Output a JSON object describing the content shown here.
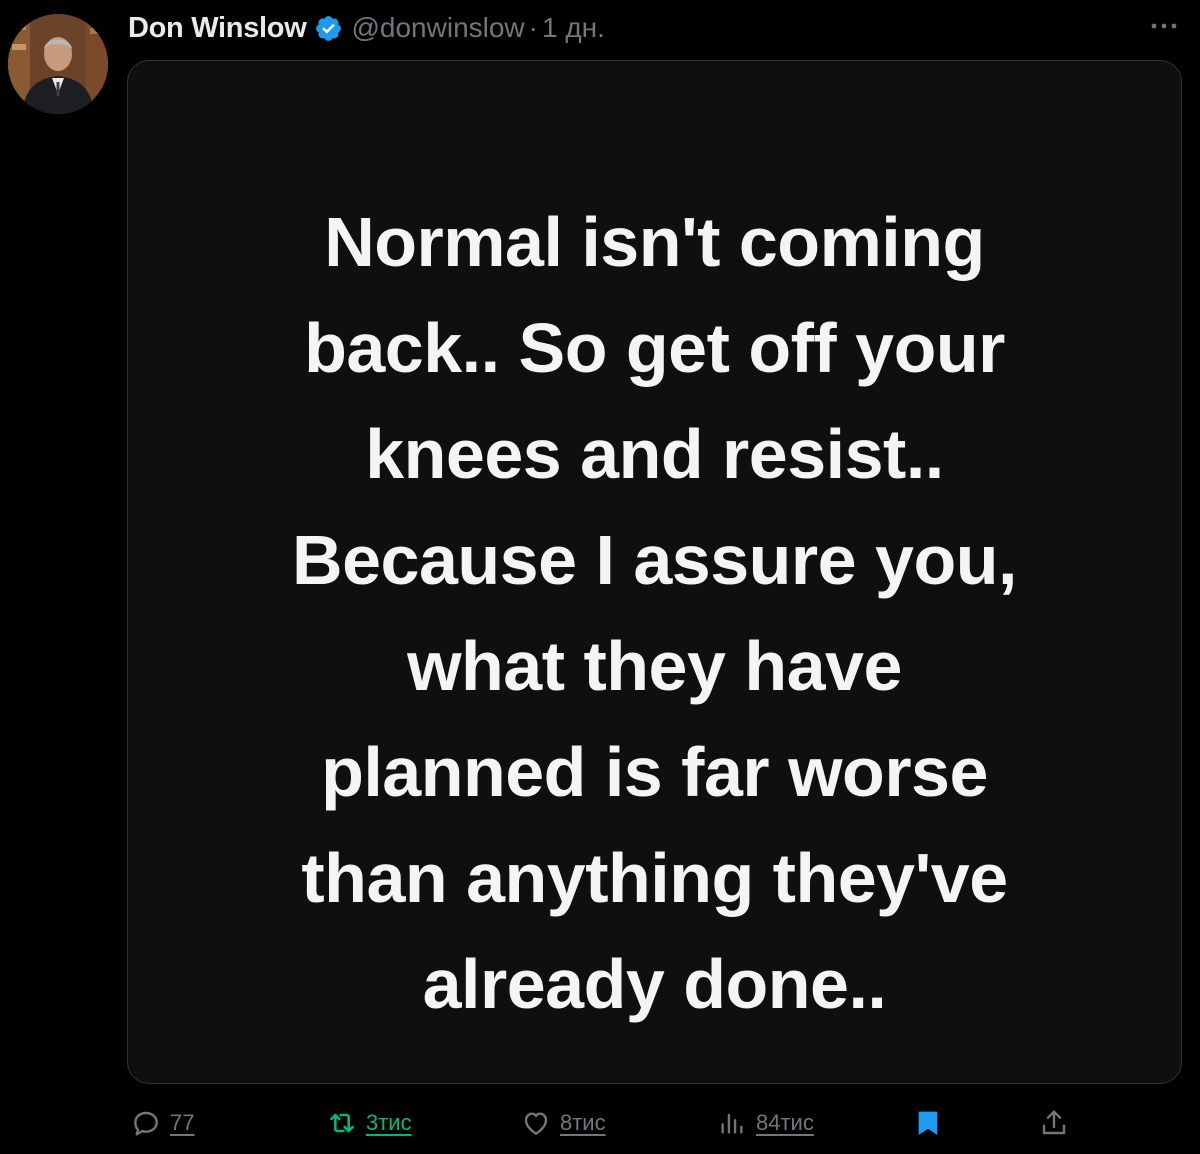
{
  "author": {
    "display_name": "Don Winslow",
    "handle": "@donwinslow",
    "separator": "·",
    "time_ago": "1 дн.",
    "verified_color": "#1d9bf0"
  },
  "media": {
    "lines": [
      "Normal isn't coming",
      "back.. So get off your",
      "knees and resist..",
      "Because I assure you,",
      "what they have",
      "planned is far worse",
      "than anything they've",
      "already done.."
    ]
  },
  "actions": {
    "replies": "77",
    "reposts": "3тис",
    "likes": "8тис",
    "views": "84тис",
    "bookmark_color": "#1d9bf0",
    "repost_color": "#00ba7c"
  },
  "icons": {
    "reply": "speech-bubble-icon",
    "repost": "repost-arrows-icon",
    "like": "heart-icon",
    "views": "bar-chart-icon",
    "bookmark": "bookmark-icon",
    "share": "share-icon",
    "more": "more-dots-icon"
  }
}
